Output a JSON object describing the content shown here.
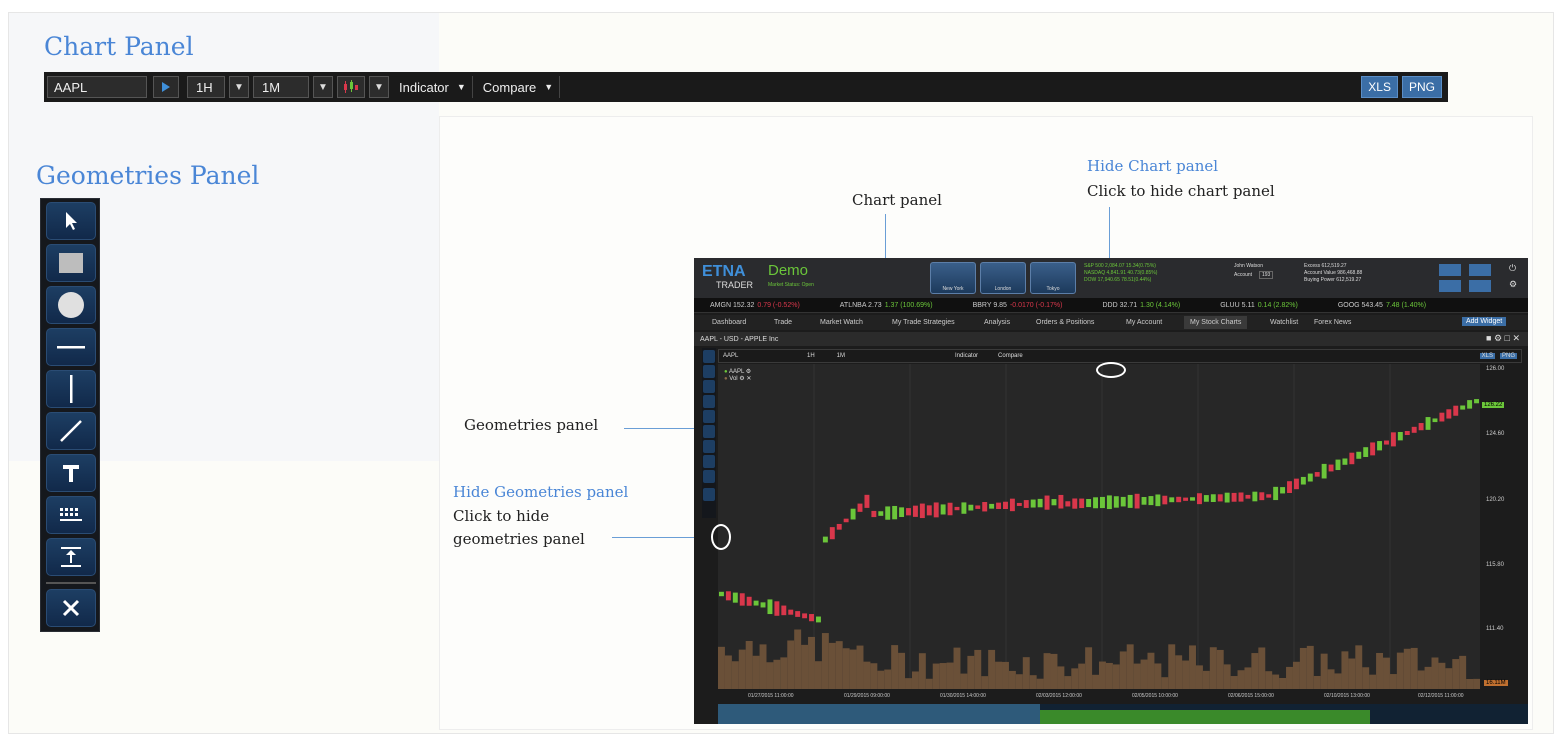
{
  "titles": {
    "chart_panel": "Chart Panel",
    "geometries_panel": "Geometries Panel"
  },
  "toolbar": {
    "symbol": "AAPL",
    "interval": "1H",
    "range": "1M",
    "indicator": "Indicator",
    "compare": "Compare",
    "xls": "XLS",
    "png": "PNG"
  },
  "geometries": [
    "cursor-icon",
    "rectangle-icon",
    "circle-icon",
    "horizontal-line-icon",
    "vertical-line-icon",
    "trend-line-icon",
    "text-icon",
    "fibonacci-icon",
    "price-range-icon",
    "delete-icon"
  ],
  "annotations": {
    "chart_panel": "Chart panel",
    "hide_chart_title": "Hide Chart panel",
    "hide_chart_desc": "Click to hide chart panel",
    "geometries_panel": "Geometries panel",
    "hide_geo_title": "Hide Geometries panel",
    "hide_geo_desc1": "Click to hide",
    "hide_geo_desc2": "geometries panel"
  },
  "app": {
    "logo": "ETNA",
    "logo_sub": "TRADER",
    "mode": "Demo",
    "market_status": "Market Status: Open",
    "clocks": [
      "New York",
      "London",
      "Tokyo"
    ],
    "indices": [
      {
        "name": "S&P 500",
        "value": "2,084.07",
        "change": "15.34(0.75%)"
      },
      {
        "name": "NASDAQ",
        "value": "4,841.91",
        "change": "40.73(0.85%)"
      },
      {
        "name": "DOW",
        "value": "17,940.65",
        "change": "78.51(0.44%)"
      }
    ],
    "user": "John Watson",
    "account_label": "Account",
    "account_value": "193",
    "balances": [
      {
        "label": "Excess",
        "value": "612,519.27"
      },
      {
        "label": "Account Value",
        "value": "986,468.88"
      },
      {
        "label": "Buying Power",
        "value": "612,519.27"
      }
    ],
    "ticker": [
      {
        "sym": "AMGN 152.32",
        "chg": "0.79 (-0.52%)",
        "dir": "down"
      },
      {
        "sym": "ATLNBA 2.73",
        "chg": "1.37 (100.69%)",
        "dir": "up"
      },
      {
        "sym": "BBRY 9.85",
        "chg": "-0.0170 (-0.17%)",
        "dir": "down"
      },
      {
        "sym": "DDD 32.71",
        "chg": "1.30 (4.14%)",
        "dir": "up"
      },
      {
        "sym": "GLUU 5.11",
        "chg": "0.14 (2.82%)",
        "dir": "up"
      },
      {
        "sym": "GOOG 543.45",
        "chg": "7.48 (1.40%)",
        "dir": "up"
      }
    ],
    "tabs": [
      "Dashboard",
      "Trade",
      "Market Watch",
      "My Trade Strategies",
      "Analysis",
      "Orders & Positions",
      "My Account",
      "My Stock Charts",
      "Watchlist",
      "Forex News"
    ],
    "active_tab": "My Stock Charts",
    "add_widget": "Add Widget",
    "window_title": "AAPL - USD - APPLE Inc",
    "legend": [
      "AAPL",
      "Vol"
    ],
    "price_label": "126.22",
    "vol_label": "16.11M",
    "y_ticks": [
      "126.00",
      "124.60",
      "120.20",
      "115.80",
      "111.40"
    ],
    "x_ticks": [
      "01/27/2015 11:00:00",
      "01/29/2015 09:00:00",
      "01/30/2015 14:00:00",
      "02/03/2015 12:00:00",
      "02/05/2015 10:00:00",
      "02/06/2015 15:00:00",
      "02/10/2015 13:00:00",
      "02/12/2015 11:00:00"
    ]
  },
  "colors": {
    "accent": "#4a86d6",
    "up": "#6bc63a",
    "down": "#d9374b",
    "volume": "#8a6a4a"
  }
}
